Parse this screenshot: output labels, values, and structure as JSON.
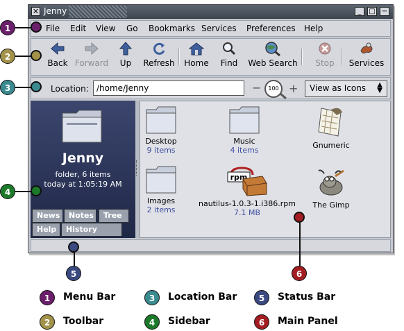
{
  "window": {
    "title": "Jenny",
    "controls": [
      "_",
      "□",
      "−"
    ]
  },
  "menubar": {
    "items": [
      "File",
      "Edit",
      "View",
      "Go",
      "Bookmarks",
      "Services",
      "Preferences",
      "Help"
    ]
  },
  "toolbar": {
    "items": [
      {
        "label": "Back",
        "icon": "back-arrow-icon",
        "enabled": true
      },
      {
        "label": "Forward",
        "icon": "forward-arrow-icon",
        "enabled": false
      },
      {
        "label": "Up",
        "icon": "up-arrow-icon",
        "enabled": true
      },
      {
        "label": "Refresh",
        "icon": "refresh-icon",
        "enabled": true
      },
      {
        "label": "Home",
        "icon": "home-icon",
        "enabled": true
      },
      {
        "label": "Find",
        "icon": "find-icon",
        "enabled": true
      },
      {
        "label": "Web Search",
        "icon": "web-search-icon",
        "enabled": true
      },
      {
        "label": "Stop",
        "icon": "stop-icon",
        "enabled": false
      },
      {
        "label": "Services",
        "icon": "services-icon",
        "enabled": true
      }
    ]
  },
  "locationbar": {
    "label": "Location:",
    "value": "/home/Jenny",
    "zoom_level": "100",
    "view_mode": "View as Icons"
  },
  "sidebar": {
    "folder_name": "Jenny",
    "folder_info": "folder, 6 items",
    "folder_date": "today at 1:05:19 AM",
    "tabs": [
      "News",
      "Notes",
      "Tree",
      "Help",
      "History"
    ]
  },
  "mainpanel": {
    "items": [
      {
        "name": "Desktop",
        "sub": "9 items",
        "icon": "folder-icon"
      },
      {
        "name": "Music",
        "sub": "4 items",
        "icon": "folder-icon"
      },
      {
        "name": "Gnumeric",
        "sub": "",
        "icon": "gnumeric-icon"
      },
      {
        "name": "Images",
        "sub": "2 items",
        "icon": "folder-icon"
      },
      {
        "name": "nautilus-1.0.3-1.i386.rpm",
        "sub": "7.1 MB",
        "icon": "rpm-package-icon"
      },
      {
        "name": "The Gimp",
        "sub": "",
        "icon": "gimp-icon"
      }
    ]
  },
  "callouts": [
    {
      "num": "1",
      "color": "#6b1f6b"
    },
    {
      "num": "2",
      "color": "#a2924a"
    },
    {
      "num": "3",
      "color": "#3a8a90"
    },
    {
      "num": "4",
      "color": "#1c7a2a"
    },
    {
      "num": "5",
      "color": "#3a4a80"
    },
    {
      "num": "6",
      "color": "#a21e22"
    }
  ],
  "legend": [
    {
      "num": "1",
      "label": "Menu Bar",
      "color": "#6b1f6b"
    },
    {
      "num": "3",
      "label": "Location Bar",
      "color": "#3a8a90"
    },
    {
      "num": "5",
      "label": "Status Bar",
      "color": "#3a4a80"
    },
    {
      "num": "2",
      "label": "Toolbar",
      "color": "#a2924a"
    },
    {
      "num": "4",
      "label": "Sidebar",
      "color": "#1c7a2a"
    },
    {
      "num": "6",
      "label": "Main Panel",
      "color": "#a21e22"
    }
  ]
}
